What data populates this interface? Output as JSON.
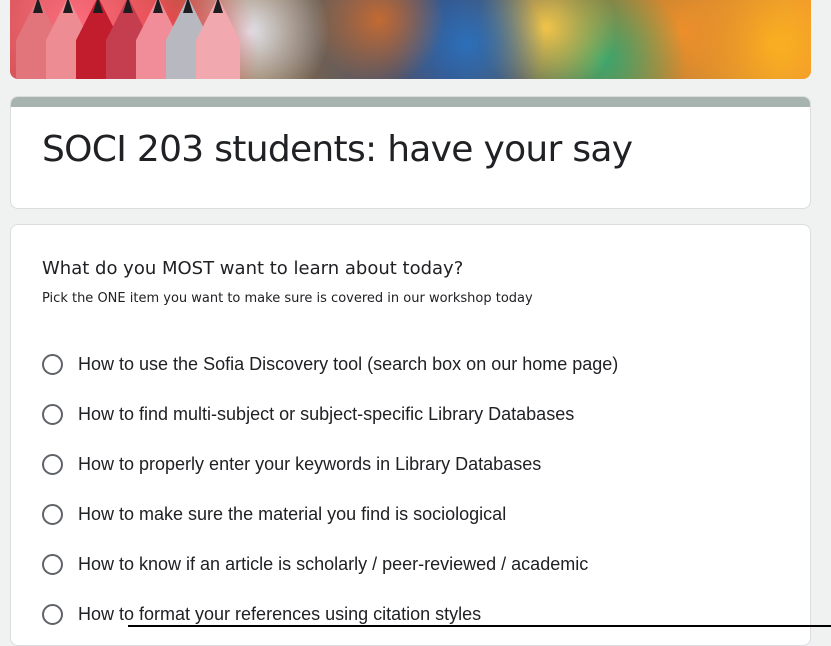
{
  "form": {
    "title": "SOCI 203 students: have your say",
    "question": {
      "text": "What do you MOST want to learn about today?",
      "description": "Pick the ONE item you want to make sure is covered in our workshop today",
      "options": [
        "How to use the Sofia Discovery tool (search box on our home page)",
        "How to find multi-subject or subject-specific Library Databases",
        "How to properly enter your keywords in Library Databases",
        "How to make sure the material you find is sociological",
        "How to know if an article is scholarly / peer-reviewed / academic",
        "How to format your references using citation styles"
      ]
    }
  },
  "theme": {
    "header_accent": "#a7b3ae",
    "page_background": "#f0f2f1",
    "text": "#202124"
  }
}
